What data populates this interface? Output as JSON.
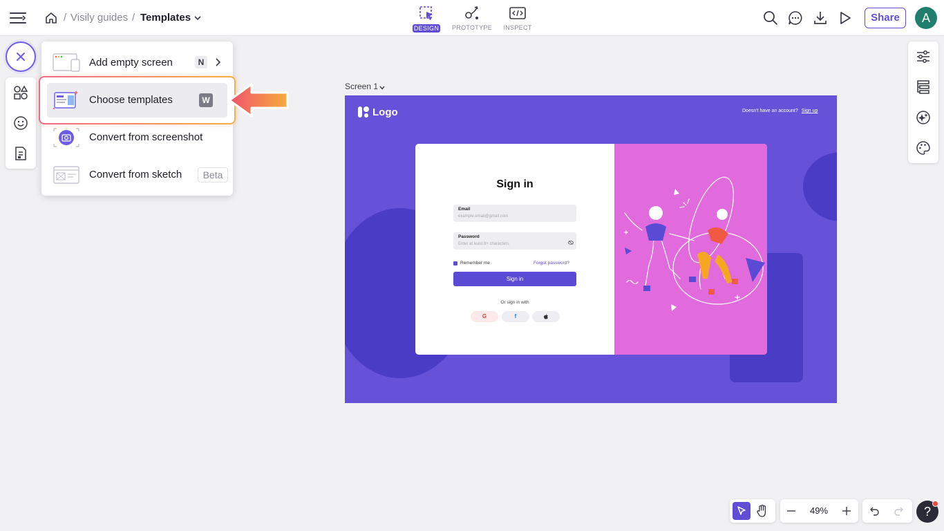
{
  "breadcrumb": {
    "separator": "/",
    "parent": "Visily guides",
    "current": "Templates"
  },
  "modes": [
    {
      "label": "DESIGN",
      "active": true
    },
    {
      "label": "PROTOTYPE",
      "active": false
    },
    {
      "label": "INSPECT",
      "active": false
    }
  ],
  "topbar": {
    "share_label": "Share",
    "avatar_initial": "A"
  },
  "menu": {
    "items": [
      {
        "label": "Add empty screen",
        "shortcut": "N"
      },
      {
        "label": "Choose templates",
        "shortcut": "W"
      },
      {
        "label": "Convert from screenshot"
      },
      {
        "label": "Convert from sketch",
        "badge": "Beta"
      }
    ]
  },
  "canvas": {
    "frame_label": "Screen 1",
    "screen": {
      "logo": "Logo",
      "no_account": "Doesn't have an account?",
      "sign_up": "Sign up",
      "title": "Sign in",
      "email_label": "Email",
      "email_placeholder": "example.email@gmail.com",
      "password_label": "Password",
      "password_placeholder": "Enter at least 8+ characters",
      "remember": "Remember me",
      "forgot": "Forgot password?",
      "button": "Sign in",
      "or": "Or sign in with",
      "social": [
        "G",
        "f",
        ""
      ]
    }
  },
  "bottom": {
    "zoom": "49%",
    "help": "?"
  },
  "colors": {
    "accent": "#5f4dd6",
    "artboard": "#6651d9",
    "card_art": "#e16bdc",
    "arrow": "#f07a6e"
  }
}
